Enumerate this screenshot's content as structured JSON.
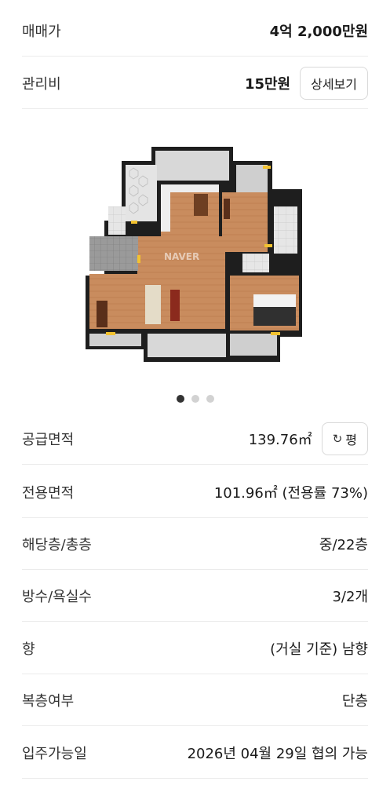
{
  "price": {
    "label": "매매가",
    "value": "4억 2,000만원"
  },
  "maintenance": {
    "label": "관리비",
    "value": "15만원",
    "detail_button": "상세보기"
  },
  "floorplan": {
    "watermark": "NAVER"
  },
  "carousel": {
    "count": 3,
    "active_index": 0
  },
  "supply_area": {
    "label": "공급면적",
    "value": "139.76㎡",
    "unit_toggle_icon": "refresh-icon",
    "unit_toggle_label": "평"
  },
  "exclusive_area": {
    "label": "전용면적",
    "value": "101.96㎡ (전용률 73%)"
  },
  "floor": {
    "label": "해당층/총층",
    "value": "중/22층"
  },
  "rooms": {
    "label": "방수/욕실수",
    "value": "3/2개"
  },
  "direction": {
    "label": "향",
    "value": "(거실 기준) 남향"
  },
  "duplex": {
    "label": "복층여부",
    "value": "단층"
  },
  "move_in": {
    "label": "입주가능일",
    "value": "2026년 04월 29일 협의 가능"
  }
}
